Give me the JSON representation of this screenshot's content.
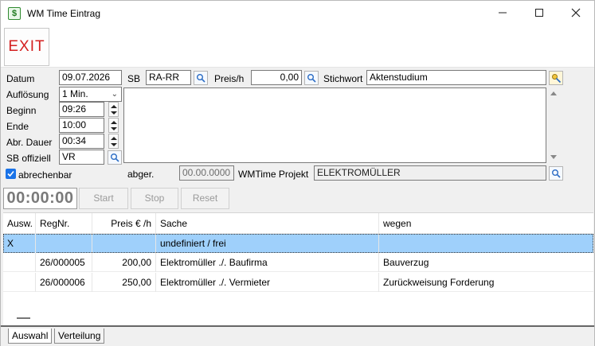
{
  "window": {
    "title": "WM Time Eintrag",
    "icon": "dollar-doc-icon",
    "controls": [
      "minimize",
      "maximize",
      "close"
    ]
  },
  "toolbar": {
    "exit_label": "EXIT"
  },
  "form": {
    "datum_label": "Datum",
    "datum_value": "09.07.2026",
    "sb_label": "SB",
    "sb_value": "RA-RR",
    "preis_label": "Preis/h",
    "preis_value": "0,00",
    "stichwort_label": "Stichwort",
    "stichwort_value": "Aktenstudium",
    "aufloesung_label": "Auflösung",
    "aufloesung_value": "1 Min.",
    "beginn_label": "Beginn",
    "beginn_value": "09:26",
    "ende_label": "Ende",
    "ende_value": "10:00",
    "abr_dauer_label": "Abr. Dauer",
    "abr_dauer_value": "00:34",
    "sb_offiziell_label": "SB offiziell",
    "sb_offiziell_value": "VR",
    "abrechenbar_label": "abrechenbar",
    "abrechenbar_checked": true,
    "abger_label": "abger.",
    "abger_value": "00.00.0000",
    "projekt_label": "WMTime Projekt",
    "projekt_value": "ELEKTROMÜLLER"
  },
  "timer": {
    "display": "00:00:00",
    "start_label": "Start",
    "stop_label": "Stop",
    "reset_label": "Reset"
  },
  "table": {
    "headers": [
      "Ausw.",
      "RegNr.",
      "Preis € /h",
      "Sache",
      "wegen"
    ],
    "rows": [
      {
        "ausw": "X",
        "regnr": "",
        "preis": "",
        "sache": "undefiniert / frei",
        "wegen": "",
        "selected": true
      },
      {
        "ausw": "",
        "regnr": "26/000005",
        "preis": "200,00",
        "sache": "Elektromüller ./. Baufirma",
        "wegen": "Bauverzug",
        "selected": false
      },
      {
        "ausw": "",
        "regnr": "26/000006",
        "preis": "250,00",
        "sache": "Elektromüller ./. Vermieter",
        "wegen": "Zurückweisung Forderung",
        "selected": false
      }
    ]
  },
  "tabs": [
    "Auswahl",
    "Verteilung"
  ],
  "colors": {
    "exit": "#d42020",
    "selection": "#9fd0fb",
    "checkbox": "#1a73e8"
  }
}
